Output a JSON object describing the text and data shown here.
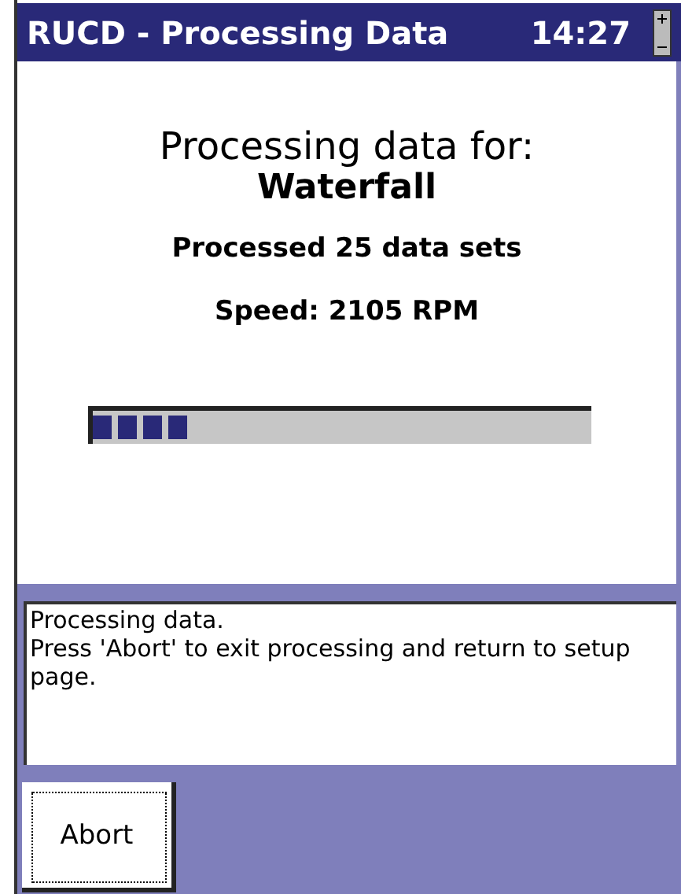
{
  "window": {
    "title": "RUCD - Processing Data",
    "time": "14:27"
  },
  "status": {
    "heading": "Processing data for:",
    "subject": "Waterfall",
    "count": "Processed 25 data sets",
    "speed": "Speed: 2105 RPM"
  },
  "progress": {
    "level": 0.2
  },
  "message": [
    "Processing data.",
    "Press 'Abort' to exit processing and return to setup page."
  ],
  "buttons": [
    "Abort"
  ]
}
